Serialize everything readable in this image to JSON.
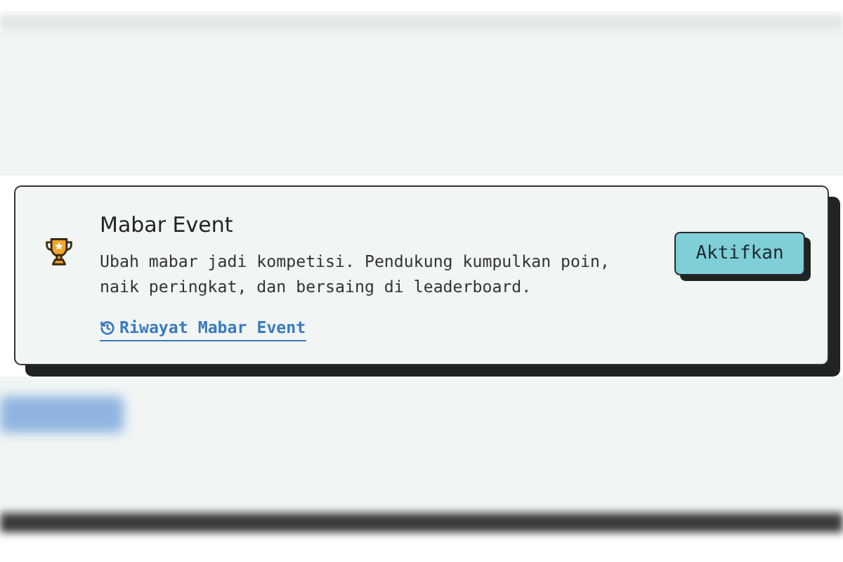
{
  "event_card": {
    "title": "Mabar Event",
    "description": "Ubah mabar jadi kompetisi. Pendukung kumpulkan poin, naik peringkat, dan bersaing di leaderboard.",
    "history_link": "Riwayat Mabar Event",
    "action_button": "Aktifkan"
  }
}
